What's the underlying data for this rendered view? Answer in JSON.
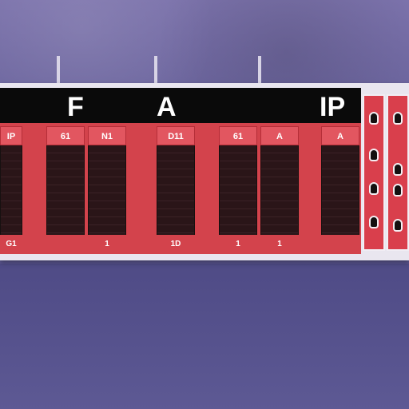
{
  "scoreboard": {
    "header_letters": [
      "F",
      "A",
      "IP"
    ],
    "columns": [
      {
        "top": "IP",
        "bottom": "G1"
      },
      {
        "top": "61",
        "bottom": ""
      },
      {
        "top": "N1",
        "bottom": "1"
      },
      {
        "top": "D11",
        "bottom": "1D"
      },
      {
        "top": "61",
        "bottom": "1"
      },
      {
        "top": "A",
        "bottom": "1"
      },
      {
        "top": "A",
        "bottom": ""
      }
    ]
  },
  "colors": {
    "wall": "#7b72ab",
    "floor": "#57538e",
    "board_red": "#d3434c",
    "header_black": "#0a0a0a"
  }
}
